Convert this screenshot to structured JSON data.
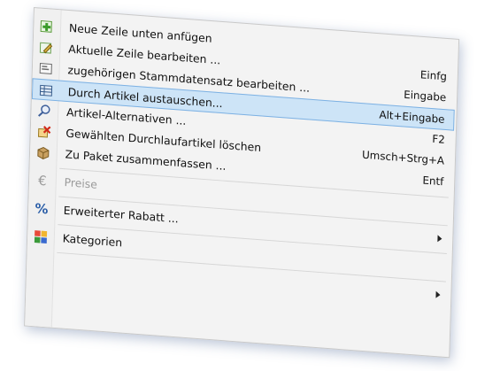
{
  "menu": {
    "items": [
      {
        "label": "Neue Zeile unten anfügen",
        "shortcut": "",
        "icon": "add-row-icon"
      },
      {
        "label": "Aktuelle Zeile bearbeiten ...",
        "shortcut": "Einfg",
        "icon": "edit-row-icon"
      },
      {
        "label": "zugehörigen Stammdatensatz bearbeiten ...",
        "shortcut": "Eingabe",
        "icon": "master-record-icon"
      },
      {
        "label": "Durch Artikel austauschen...",
        "shortcut": "Alt+Eingabe",
        "icon": "grid-table-icon"
      },
      {
        "label": "Artikel-Alternativen ...",
        "shortcut": "F2",
        "icon": "magnifier-icon"
      },
      {
        "label": "Gewählten Durchlaufartikel löschen",
        "shortcut": "Umsch+Strg+A",
        "icon": "delete-item-icon"
      },
      {
        "label": "Zu Paket zusammenfassen ...",
        "shortcut": "Entf",
        "icon": "package-icon"
      },
      {
        "label": "Preise",
        "shortcut": "",
        "icon": "euro-icon"
      },
      {
        "label": "Erweiterter Rabatt ...",
        "shortcut": "",
        "icon": "percent-icon"
      },
      {
        "label": "Kategorien",
        "shortcut": "",
        "icon": "categories-icon"
      }
    ]
  }
}
